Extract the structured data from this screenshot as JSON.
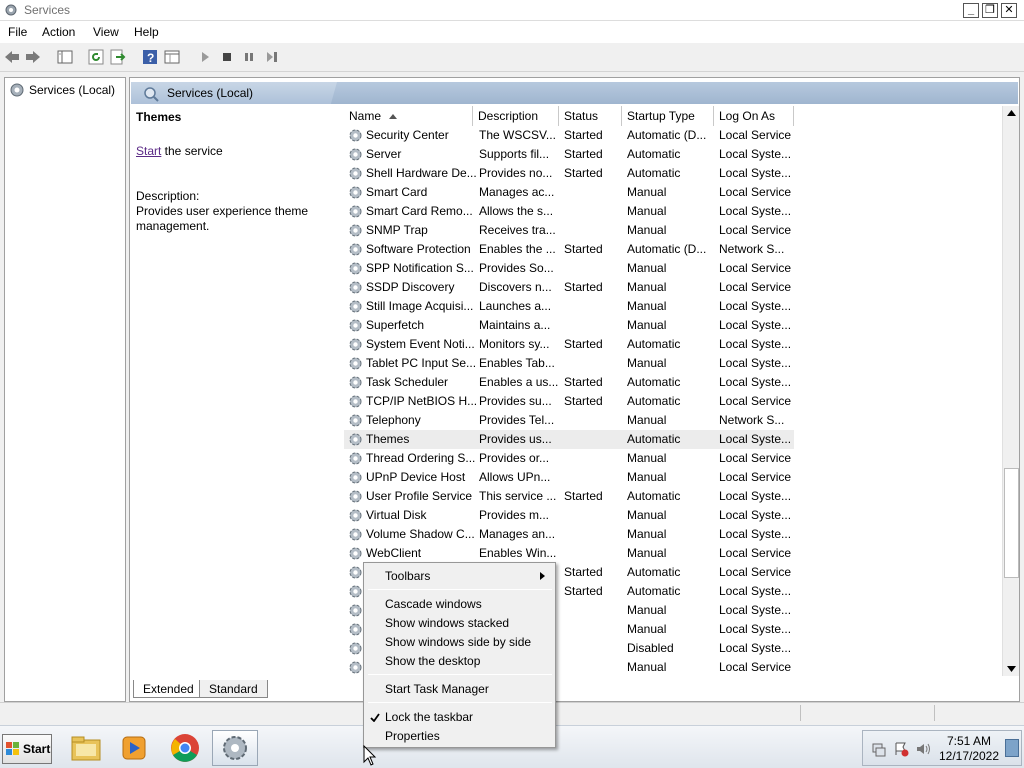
{
  "window": {
    "title": "Services",
    "controls": {
      "minimize": "_",
      "restore": "❐",
      "close": "✕"
    }
  },
  "menu": [
    "File",
    "Action",
    "View",
    "Help"
  ],
  "tree": {
    "root_label": "Services (Local)"
  },
  "main_header": {
    "label": "Services (Local)"
  },
  "description_panel": {
    "service_name": "Themes",
    "start_link": "Start",
    "start_suffix": " the service",
    "description_label": "Description:",
    "description_text": "Provides user experience theme management."
  },
  "columns": [
    "Name",
    "Description",
    "Status",
    "Startup Type",
    "Log On As"
  ],
  "services": [
    {
      "name": "Security Center",
      "description": "The WSCSV...",
      "status": "Started",
      "startup": "Automatic (D...",
      "logon": "Local Service"
    },
    {
      "name": "Server",
      "description": "Supports fil...",
      "status": "Started",
      "startup": "Automatic",
      "logon": "Local Syste..."
    },
    {
      "name": "Shell Hardware De...",
      "description": "Provides no...",
      "status": "Started",
      "startup": "Automatic",
      "logon": "Local Syste..."
    },
    {
      "name": "Smart Card",
      "description": "Manages ac...",
      "status": "",
      "startup": "Manual",
      "logon": "Local Service"
    },
    {
      "name": "Smart Card Remo...",
      "description": "Allows the s...",
      "status": "",
      "startup": "Manual",
      "logon": "Local Syste..."
    },
    {
      "name": "SNMP Trap",
      "description": "Receives tra...",
      "status": "",
      "startup": "Manual",
      "logon": "Local Service"
    },
    {
      "name": "Software Protection",
      "description": "Enables the ...",
      "status": "Started",
      "startup": "Automatic (D...",
      "logon": "Network S..."
    },
    {
      "name": "SPP Notification S...",
      "description": "Provides So...",
      "status": "",
      "startup": "Manual",
      "logon": "Local Service"
    },
    {
      "name": "SSDP Discovery",
      "description": "Discovers n...",
      "status": "Started",
      "startup": "Manual",
      "logon": "Local Service"
    },
    {
      "name": "Still Image Acquisi...",
      "description": "Launches a...",
      "status": "",
      "startup": "Manual",
      "logon": "Local Syste..."
    },
    {
      "name": "Superfetch",
      "description": "Maintains a...",
      "status": "",
      "startup": "Manual",
      "logon": "Local Syste..."
    },
    {
      "name": "System Event Noti...",
      "description": "Monitors sy...",
      "status": "Started",
      "startup": "Automatic",
      "logon": "Local Syste..."
    },
    {
      "name": "Tablet PC Input Se...",
      "description": "Enables Tab...",
      "status": "",
      "startup": "Manual",
      "logon": "Local Syste..."
    },
    {
      "name": "Task Scheduler",
      "description": "Enables a us...",
      "status": "Started",
      "startup": "Automatic",
      "logon": "Local Syste..."
    },
    {
      "name": "TCP/IP NetBIOS H...",
      "description": "Provides su...",
      "status": "Started",
      "startup": "Automatic",
      "logon": "Local Service"
    },
    {
      "name": "Telephony",
      "description": "Provides Tel...",
      "status": "",
      "startup": "Manual",
      "logon": "Network S..."
    },
    {
      "name": "Themes",
      "description": "Provides us...",
      "status": "",
      "startup": "Automatic",
      "logon": "Local Syste..."
    },
    {
      "name": "Thread Ordering S...",
      "description": "Provides or...",
      "status": "",
      "startup": "Manual",
      "logon": "Local Service"
    },
    {
      "name": "UPnP Device Host",
      "description": "Allows UPn...",
      "status": "",
      "startup": "Manual",
      "logon": "Local Service"
    },
    {
      "name": "User Profile Service",
      "description": "This service ...",
      "status": "Started",
      "startup": "Automatic",
      "logon": "Local Syste..."
    },
    {
      "name": "Virtual Disk",
      "description": "Provides m...",
      "status": "",
      "startup": "Manual",
      "logon": "Local Syste..."
    },
    {
      "name": "Volume Shadow C...",
      "description": "Manages an...",
      "status": "",
      "startup": "Manual",
      "logon": "Local Syste..."
    },
    {
      "name": "WebClient",
      "description": "Enables Win...",
      "status": "",
      "startup": "Manual",
      "logon": "Local Service"
    },
    {
      "name": "",
      "description": "",
      "status": "Started",
      "startup": "Automatic",
      "logon": "Local Service"
    },
    {
      "name": "",
      "description": "",
      "status": "Started",
      "startup": "Automatic",
      "logon": "Local Syste..."
    },
    {
      "name": "",
      "description": "",
      "status": "",
      "startup": "Manual",
      "logon": "Local Syste..."
    },
    {
      "name": "",
      "description": "",
      "status": "",
      "startup": "Manual",
      "logon": "Local Syste..."
    },
    {
      "name": "",
      "description": "",
      "status": "",
      "startup": "Disabled",
      "logon": "Local Syste..."
    },
    {
      "name": "",
      "description": "",
      "status": "",
      "startup": "Manual",
      "logon": "Local Service"
    }
  ],
  "selected_service": "Themes",
  "bottom_tabs": [
    "Extended",
    "Standard"
  ],
  "context_menu": {
    "items": [
      {
        "label": "Toolbars",
        "submenu": true
      },
      {
        "label": "Cascade windows"
      },
      {
        "label": "Show windows stacked"
      },
      {
        "label": "Show windows side by side"
      },
      {
        "label": "Show the desktop"
      },
      {
        "label": "Start Task Manager"
      },
      {
        "label": "Lock the taskbar",
        "checked": true
      },
      {
        "label": "Properties"
      }
    ]
  },
  "taskbar": {
    "start_label": "Start",
    "apps": [
      "file-explorer-icon",
      "media-player-icon",
      "chrome-icon",
      "services-icon"
    ],
    "clock_time": "7:51 AM",
    "clock_date": "12/17/2022"
  },
  "colors": {
    "link": "#5b2a86",
    "header_blue": "#a9bdd6",
    "selection": "#ececec"
  }
}
